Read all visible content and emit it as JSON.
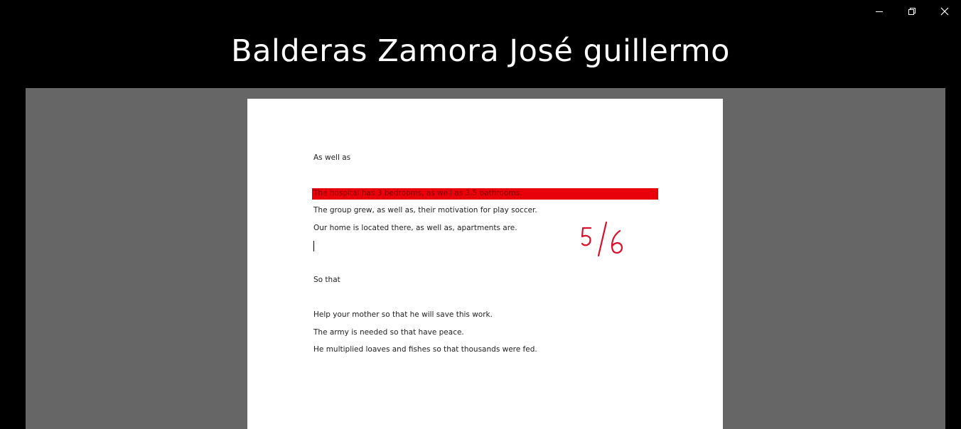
{
  "window": {
    "title": "Balderas Zamora José guillermo",
    "controls": [
      "minimize-icon",
      "restore-icon",
      "close-icon"
    ]
  },
  "document": {
    "section1_heading": "As well as",
    "highlighted_sentence": "The hospital has 3 bedrooms, as well as 3.5 bathrooms.",
    "highlight_color": "#e8000b",
    "sentence_2": "The group grew, as well as, their motivation for play soccer.",
    "sentence_3": "Our home is located there, as well as, apartments are.",
    "section2_heading": "So that",
    "sentence_4": "Help your mother so that he will save this work.",
    "sentence_5": "The army is needed so that have peace.",
    "sentence_6": "He multiplied loaves and fishes so that thousands were fed.",
    "handwritten_score": "5/6",
    "score_color": "#d8102a"
  }
}
